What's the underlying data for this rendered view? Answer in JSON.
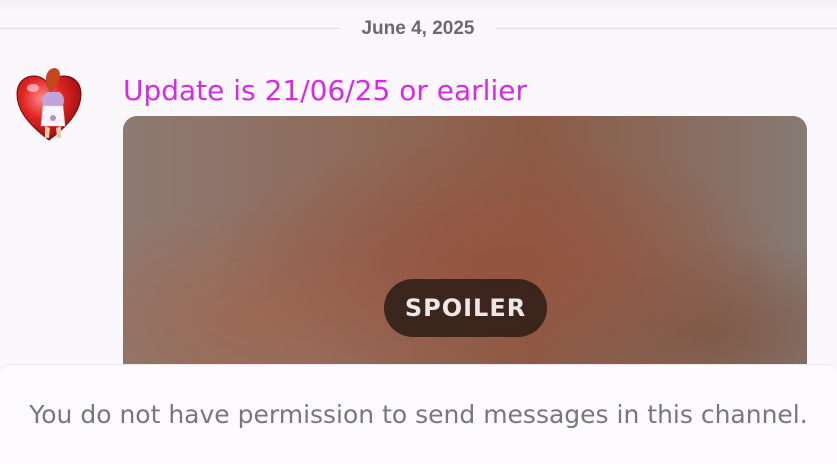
{
  "divider": {
    "date": "June 4, 2025"
  },
  "message": {
    "author_avatar_icon": "heart-avatar-icon",
    "text": "Update is 21/06/25 or earlier",
    "text_color": "#d72ae6"
  },
  "attachment": {
    "spoiler_label": "SPOILER"
  },
  "composer": {
    "permission_notice": "You do not have permission to send messages in this channel."
  }
}
